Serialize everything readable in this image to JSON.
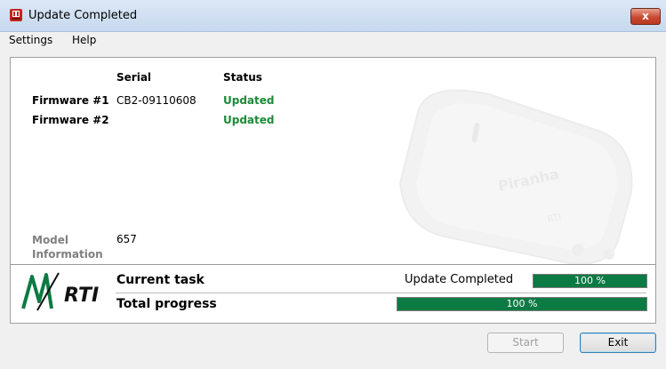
{
  "window": {
    "title": "Update Completed",
    "close_label": "x"
  },
  "menu": {
    "items": [
      {
        "label": "Settings"
      },
      {
        "label": "Help"
      }
    ]
  },
  "table": {
    "headers": {
      "serial": "Serial",
      "status": "Status"
    },
    "rows": [
      {
        "label": "Firmware #1",
        "serial": "CB2-09110608",
        "status": "Updated"
      },
      {
        "label": "Firmware #2",
        "serial": "",
        "status": "Updated"
      }
    ]
  },
  "model": {
    "label_line1": "Model",
    "label_line2": "Information",
    "value": "657"
  },
  "device_image": {
    "brand_text": "Piranha",
    "sub_text": "RTI"
  },
  "logo": {
    "text": "RTI"
  },
  "progress": {
    "current_task_label": "Current task",
    "current_task_status": "Update Completed",
    "current_task_text": "100 %",
    "current_task_value": 1.0,
    "total_label": "Total progress",
    "total_text": "100 %",
    "total_value": 1.0
  },
  "buttons": {
    "start": "Start",
    "exit": "Exit"
  },
  "colors": {
    "status_updated": "#1d8a3a",
    "progress_fill": "#0c7a43"
  }
}
